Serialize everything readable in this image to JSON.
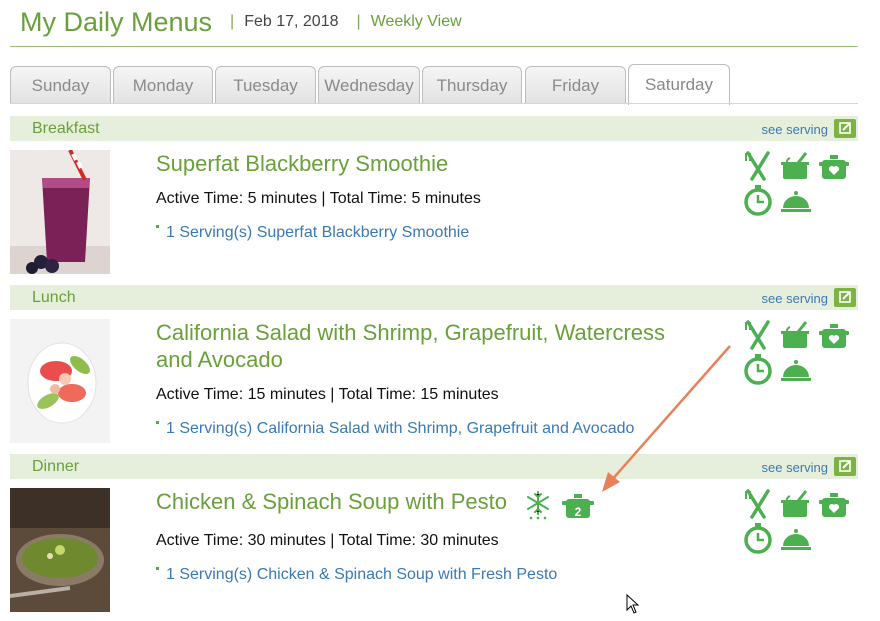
{
  "header": {
    "title": "My Daily Menus",
    "date": "Feb 17, 2018",
    "weekly_link": "Weekly View"
  },
  "tabs": [
    {
      "label": "Sunday"
    },
    {
      "label": "Monday"
    },
    {
      "label": "Tuesday"
    },
    {
      "label": "Wednesday"
    },
    {
      "label": "Thursday"
    },
    {
      "label": "Friday"
    },
    {
      "label": "Saturday",
      "active": true
    }
  ],
  "meals": [
    {
      "name": "Breakfast",
      "see_serving": "see serving",
      "recipe_title": "Superfat Blackberry Smoothie",
      "times": "Active Time: 5 minutes | Total Time: 5 minutes",
      "serving": "1 Serving(s) Superfat Blackberry Smoothie"
    },
    {
      "name": "Lunch",
      "see_serving": "see serving",
      "recipe_title_line1": "California Salad with Shrimp, Grapefruit, Watercress",
      "recipe_title_line2": "and Avocado",
      "times": "Active Time: 15 minutes | Total Time: 15 minutes",
      "serving": "1 Serving(s) California Salad with Shrimp, Grapefruit and Avocado"
    },
    {
      "name": "Dinner",
      "see_serving": "see serving",
      "recipe_title": "Chicken & Spinach Soup with Pesto",
      "leftover_count": "2",
      "times": "Active Time: 30 minutes | Total Time: 30 minutes",
      "serving": "1 Serving(s) Chicken & Spinach Soup with Fresh Pesto"
    }
  ],
  "action_icons": [
    "fork-knife-icon",
    "chef-pot-icon",
    "pot-heart-icon",
    "timer-icon",
    "cloche-icon"
  ],
  "colors": {
    "accent_green": "#6aa03a",
    "icon_green": "#4caf50",
    "link_blue": "#3a79b5",
    "bar_bg": "#e6efdc",
    "arrow": "#e8805a"
  }
}
